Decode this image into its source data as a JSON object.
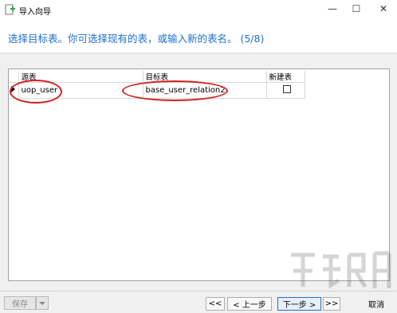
{
  "window": {
    "title": "导入向导",
    "minimize_glyph": "—",
    "maximize_glyph": "☐",
    "close_glyph": "✕"
  },
  "header": {
    "instruction": "选择目标表。你可选择现有的表，或输入新的表名。 (5/8)"
  },
  "grid": {
    "columns": {
      "source": "源表",
      "target": "目标表",
      "new_table": "新建表"
    },
    "rows": [
      {
        "source": "uop_user",
        "target": "base_user_relation2",
        "new_table": false
      }
    ]
  },
  "footer": {
    "save_label": "保存",
    "first_label": "<<",
    "prev_label": "< 上一步",
    "next_label": "下一步 >",
    "last_label": ">>",
    "cancel_label": "取消"
  },
  "colors": {
    "instruction_text": "#1e6fd0",
    "annotation_oval": "#d42020",
    "primary_button_border": "#2d6cc6"
  }
}
